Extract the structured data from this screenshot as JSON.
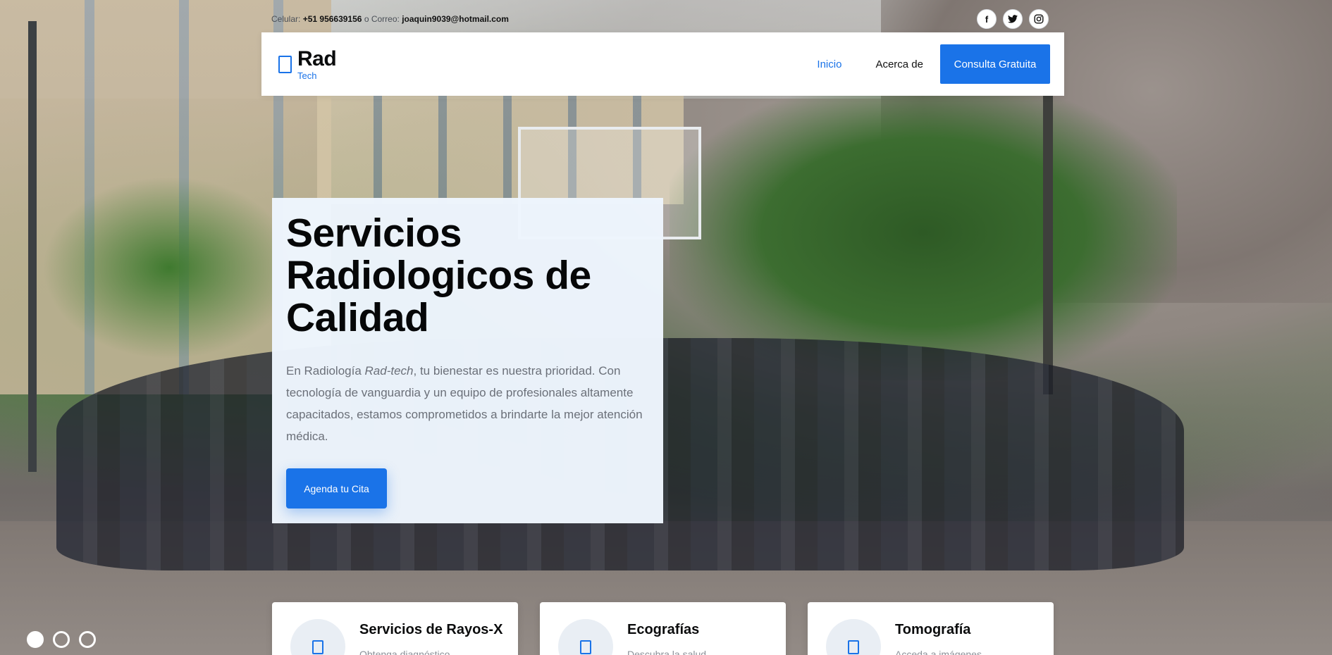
{
  "topbar": {
    "phone_label": "Celular:",
    "phone": "+51 956639156",
    "or_label": "o Correo:",
    "email": "joaquin9039@hotmail.com",
    "social": [
      {
        "icon": "facebook-icon",
        "glyph": "f"
      },
      {
        "icon": "twitter-icon",
        "glyph": "🐦"
      },
      {
        "icon": "instagram-icon",
        "glyph": "◎"
      }
    ]
  },
  "navbar": {
    "brand_name": "Rad",
    "brand_sub": "Tech",
    "links": [
      "Inicio",
      "Acerca de"
    ],
    "active_link": "Inicio",
    "cta": "Consulta Gratuita"
  },
  "hero": {
    "title": "Servicios Radiologicos de Calidad",
    "desc_prefix": "En Radiología ",
    "desc_brand": "Rad-tech",
    "desc_suffix": ", tu bienestar es nuestra prioridad. Con tecnología de vanguardia y un equipo de profesionales altamente capacitados, estamos comprometidos a brindarte la mejor atención médica.",
    "button": "Agenda tu Cita"
  },
  "carousel": {
    "slides": 3,
    "active": 1
  },
  "services": [
    {
      "title": "Servicios de Rayos-X",
      "text": "Obtenga diagnóstico"
    },
    {
      "title": "Ecografías",
      "text": "Descubra la salud"
    },
    {
      "title": "Tomografía",
      "text": "Acceda a imágenes"
    }
  ],
  "colors": {
    "accent": "#1a73e8",
    "card_bg": "#eef5fd"
  }
}
